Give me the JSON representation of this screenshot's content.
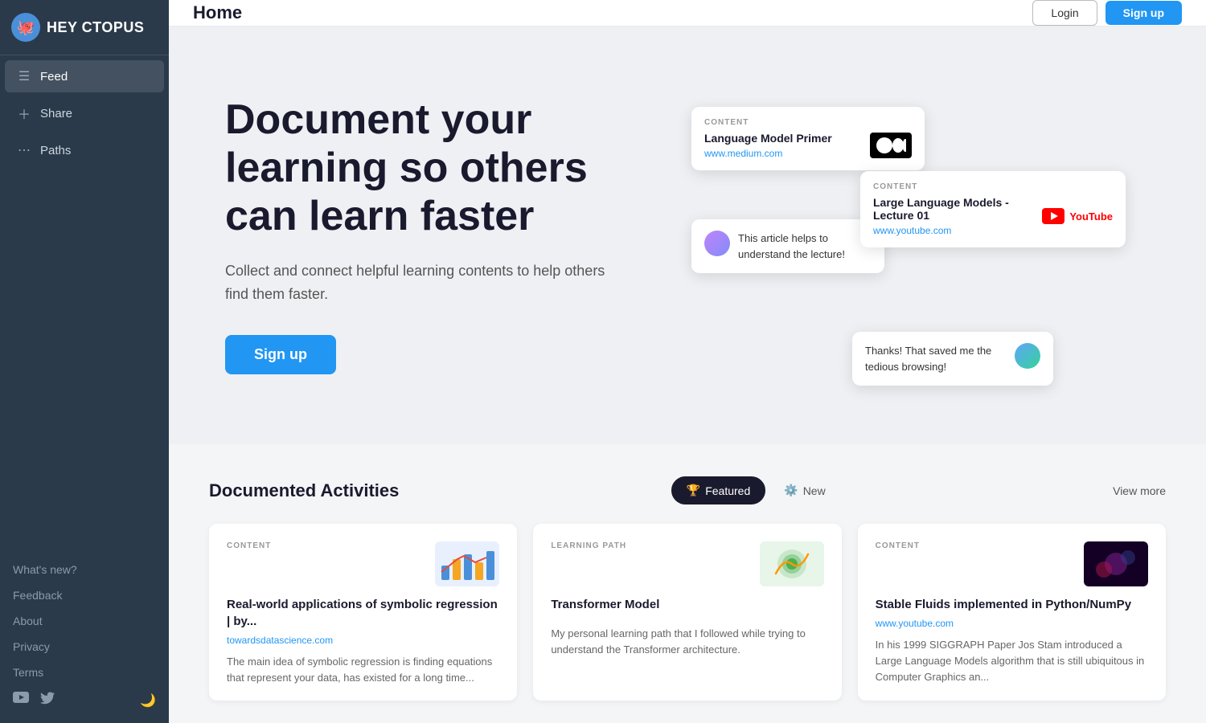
{
  "sidebar": {
    "logo_emoji": "🐙",
    "logo_text": "HEY CTOPUS",
    "items": [
      {
        "id": "feed",
        "label": "Feed",
        "icon": "☰",
        "active": true
      },
      {
        "id": "share",
        "label": "Share",
        "icon": "＋"
      },
      {
        "id": "paths",
        "label": "Paths",
        "icon": "⋯"
      }
    ],
    "bottom_links": [
      {
        "id": "whats-new",
        "label": "What's new?"
      },
      {
        "id": "feedback",
        "label": "Feedback"
      },
      {
        "id": "about",
        "label": "About"
      },
      {
        "id": "privacy",
        "label": "Privacy"
      },
      {
        "id": "terms",
        "label": "Terms"
      }
    ],
    "social": {
      "twitter_icon": "🐦",
      "youtube_icon": "▶"
    },
    "theme_icon": "🌙"
  },
  "header": {
    "title": "Home",
    "login_label": "Login",
    "signup_label": "Sign up"
  },
  "hero": {
    "title": "Document your learning so others can learn faster",
    "subtitle": "Collect and connect helpful learning contents to help others find them faster.",
    "signup_label": "Sign up",
    "card_main": {
      "content_label": "CONTENT",
      "title": "Language Model Primer",
      "url": "www.medium.com"
    },
    "card_comment": {
      "text": "This article helps to understand the lecture!"
    },
    "card_yt": {
      "content_label": "CONTENT",
      "title": "Large Language Models - Lecture 01",
      "url": "www.youtube.com"
    },
    "card_thanks": {
      "text": "Thanks! That saved me the tedious browsing!"
    }
  },
  "activities": {
    "section_title": "Documented Activities",
    "tabs": [
      {
        "id": "featured",
        "label": "Featured",
        "icon": "🏆",
        "active": true
      },
      {
        "id": "new",
        "label": "New",
        "icon": "⚙",
        "active": false
      }
    ],
    "view_more_label": "View more",
    "cards": [
      {
        "type": "CONTENT",
        "title": "Real-world applications of symbolic regression | by...",
        "domain": "towardsdatascience.com",
        "description": "The main idea of symbolic regression is finding equations that represent your data, has existed for a long time...",
        "thumb_type": "chart"
      },
      {
        "type": "LEARNING PATH",
        "title": "Transformer Model",
        "domain": "",
        "description": "My personal learning path that I followed while trying to understand the Transformer architecture.",
        "thumb_type": "path"
      },
      {
        "type": "CONTENT",
        "title": "Stable Fluids implemented in Python/NumPy",
        "domain": "www.youtube.com",
        "description": "In his 1999 SIGGRAPH Paper Jos Stam introduced a Large Language Models algorithm that is still ubiquitous in Computer Graphics an...",
        "thumb_type": "video"
      }
    ]
  }
}
